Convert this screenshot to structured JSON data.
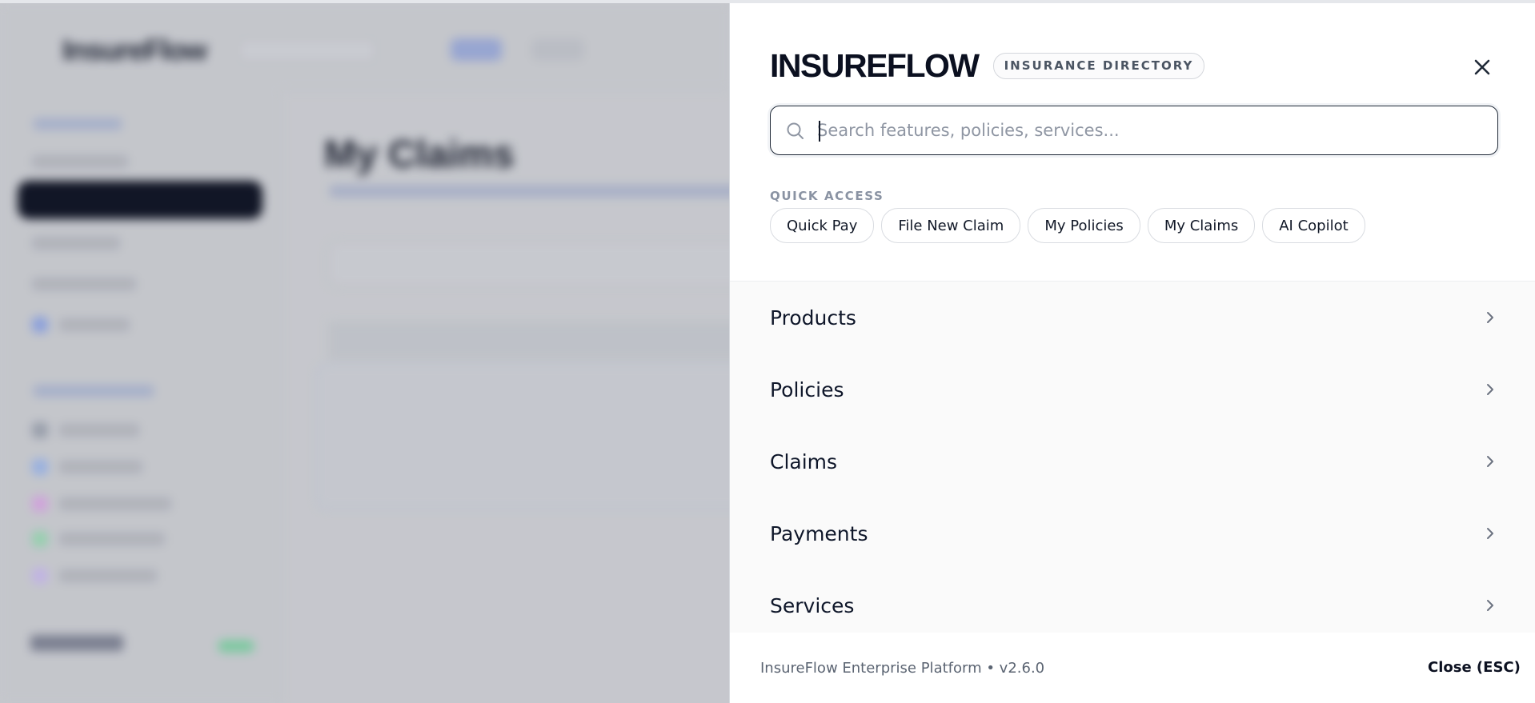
{
  "drawer": {
    "brand": "INSUREFLOW",
    "badge": "INSURANCE DIRECTORY",
    "close_icon": "close-icon",
    "search": {
      "placeholder": "Search features, policies, services...",
      "value": "",
      "icon": "search-icon"
    },
    "quick_access": {
      "label": "QUICK ACCESS",
      "chips": [
        "Quick Pay",
        "File New Claim",
        "My Policies",
        "My Claims",
        "AI Copilot"
      ]
    },
    "sections": [
      {
        "label": "Products",
        "icon": "chevron-right-icon"
      },
      {
        "label": "Policies",
        "icon": "chevron-right-icon"
      },
      {
        "label": "Claims",
        "icon": "chevron-right-icon"
      },
      {
        "label": "Payments",
        "icon": "chevron-right-icon"
      },
      {
        "label": "Services",
        "icon": "chevron-right-icon"
      }
    ],
    "footer": {
      "platform": "InsureFlow Enterprise Platform • v2.6.0",
      "close_label": "Close (ESC)"
    }
  },
  "background_page": {
    "logo": "InsureFlow",
    "title": "My Claims"
  },
  "colors": {
    "ink": "#0b1020",
    "muted": "#8a93a3",
    "panel": "#ffffff",
    "nav_bg": "#fafafa",
    "backdrop": "#c7c9ce"
  }
}
